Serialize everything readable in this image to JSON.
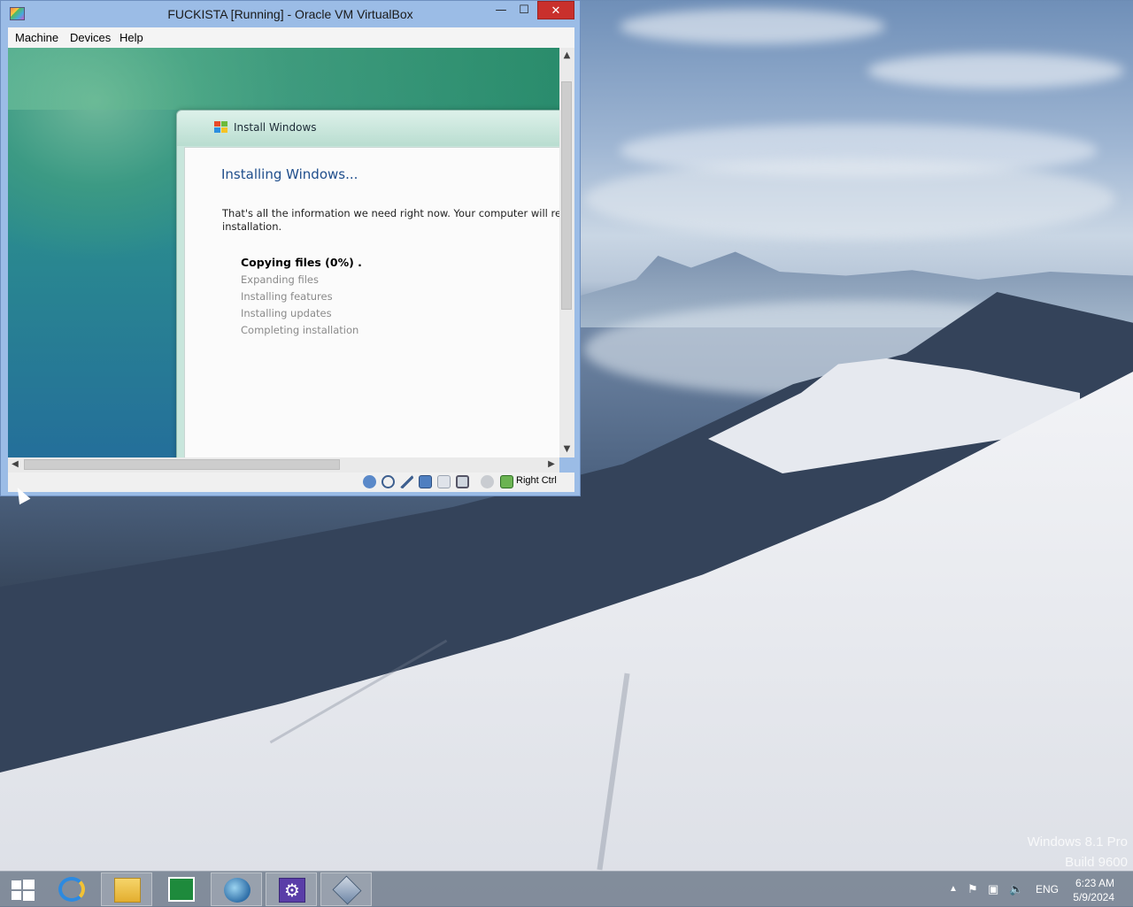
{
  "desktop": {
    "watermark_line1": "Windows 8.1 Pro",
    "watermark_line2": "Build 9600"
  },
  "vbox": {
    "title": "FUCKISTA [Running] - Oracle VM VirtualBox",
    "minimize_glyph": "—",
    "maximize_glyph": "☐",
    "close_glyph": "✕",
    "menu": [
      "Machine",
      "Devices",
      "Help"
    ],
    "host_key": "Right Ctrl",
    "status_icons": [
      "hard-disk-icon",
      "optical-drive-icon",
      "usb-icon",
      "shared-folders-icon",
      "network-icon",
      "display-icon",
      "video-capture-icon",
      "mouse-integration-icon"
    ]
  },
  "install": {
    "window_title": "Install Windows",
    "heading": "Installing Windows...",
    "info_line1": "That's all the information we need right now. Your computer will restart several times during",
    "info_line2": "installation.",
    "steps": [
      "Copying files (0%) .",
      "Expanding files",
      "Installing features",
      "Installing updates",
      "Completing installation"
    ],
    "active_step_index": 0
  },
  "taskbar": {
    "apps": [
      "start-button",
      "internet-explorer",
      "file-explorer",
      "windows-store",
      "network-globe-app",
      "settings-app",
      "virtualbox"
    ],
    "running": [
      2,
      4,
      5,
      6
    ],
    "lang": "ENG",
    "time": "6:23 AM",
    "date": "5/9/2024"
  },
  "colors": {
    "close_red": "#c9302c",
    "heading_blue": "#1f4e8c",
    "vm_teal": "#2a8a8f"
  }
}
